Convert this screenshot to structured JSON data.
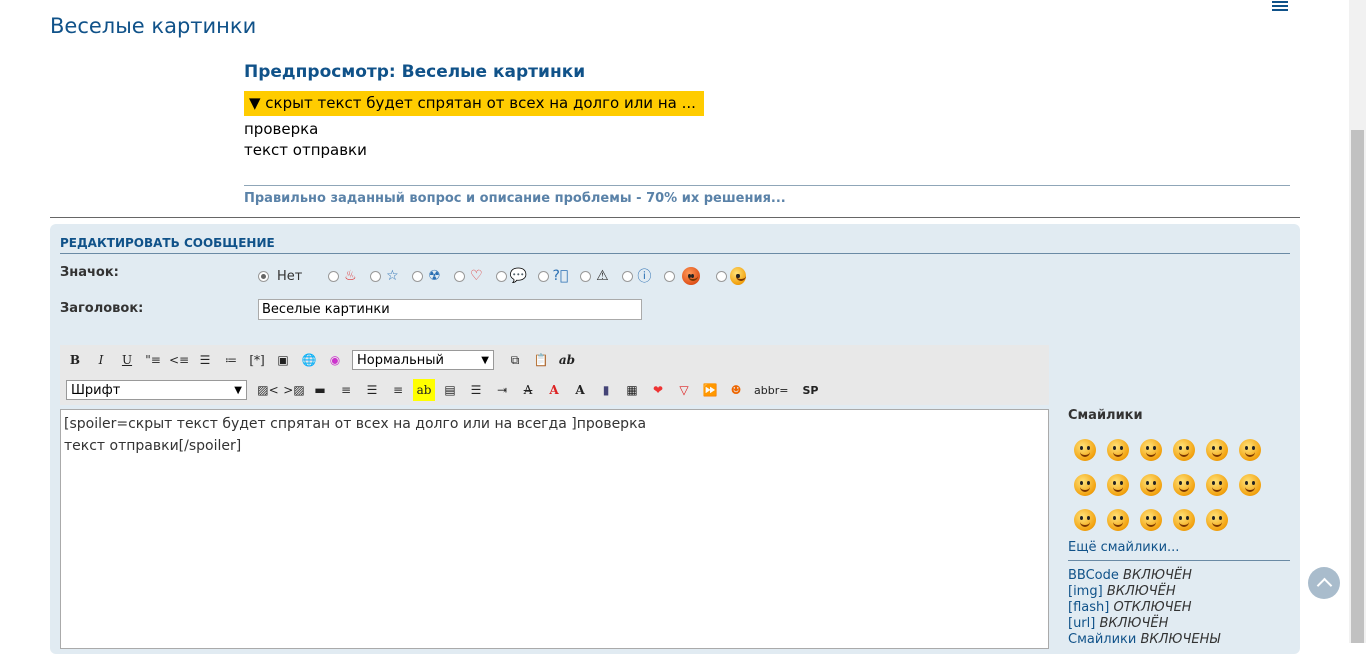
{
  "page": {
    "title": "Веселые картинки"
  },
  "preview": {
    "heading": "Предпросмотр: Веселые картинки",
    "spoiler_title": "▼ скрыт текст будет спрятан от всех на долго или на ...",
    "body_lines": [
      "проверка",
      "текст отправки"
    ],
    "signature": "Правильно заданный вопрос и описание проблемы - 70% их решения..."
  },
  "edit": {
    "panel_title": "РЕДАКТИРОВАТЬ СООБЩЕНИЕ",
    "icon_label": "Значок:",
    "icon_none": "Нет",
    "icons": [
      "fire-icon",
      "star-icon",
      "radiation-icon",
      "heart-icon",
      "speech-bubble-icon",
      "question-icon",
      "warning-icon",
      "info-icon",
      "angry-smiley-icon",
      "grin-smiley-icon"
    ],
    "subject_label": "Заголовок:",
    "subject_value": "Веселые картинки",
    "toolbar1": {
      "size_select": "Нормальный"
    },
    "toolbar2": {
      "font_select": "Шрифт",
      "abbr_label": "abbr=",
      "sp_label": "SP"
    },
    "message": "[spoiler=скрыт текст будет спрятан от всех на долго или на всегда ]проверка\nтекст отправки[/spoiler]"
  },
  "sidebar": {
    "smilies_title": "Смайлики",
    "smilies_count": 17,
    "more_smilies": "Ещё смайлики...",
    "options": [
      {
        "name": "BBCode",
        "status": "ВКЛЮЧЁН"
      },
      {
        "name": "[img]",
        "status": "ВКЛЮЧЁН"
      },
      {
        "name": "[flash]",
        "status": "ОТКЛЮЧЕН"
      },
      {
        "name": "[url]",
        "status": "ВКЛЮЧЁН"
      },
      {
        "name": "Смайлики",
        "status": "ВКЛЮЧЕНЫ"
      }
    ]
  }
}
